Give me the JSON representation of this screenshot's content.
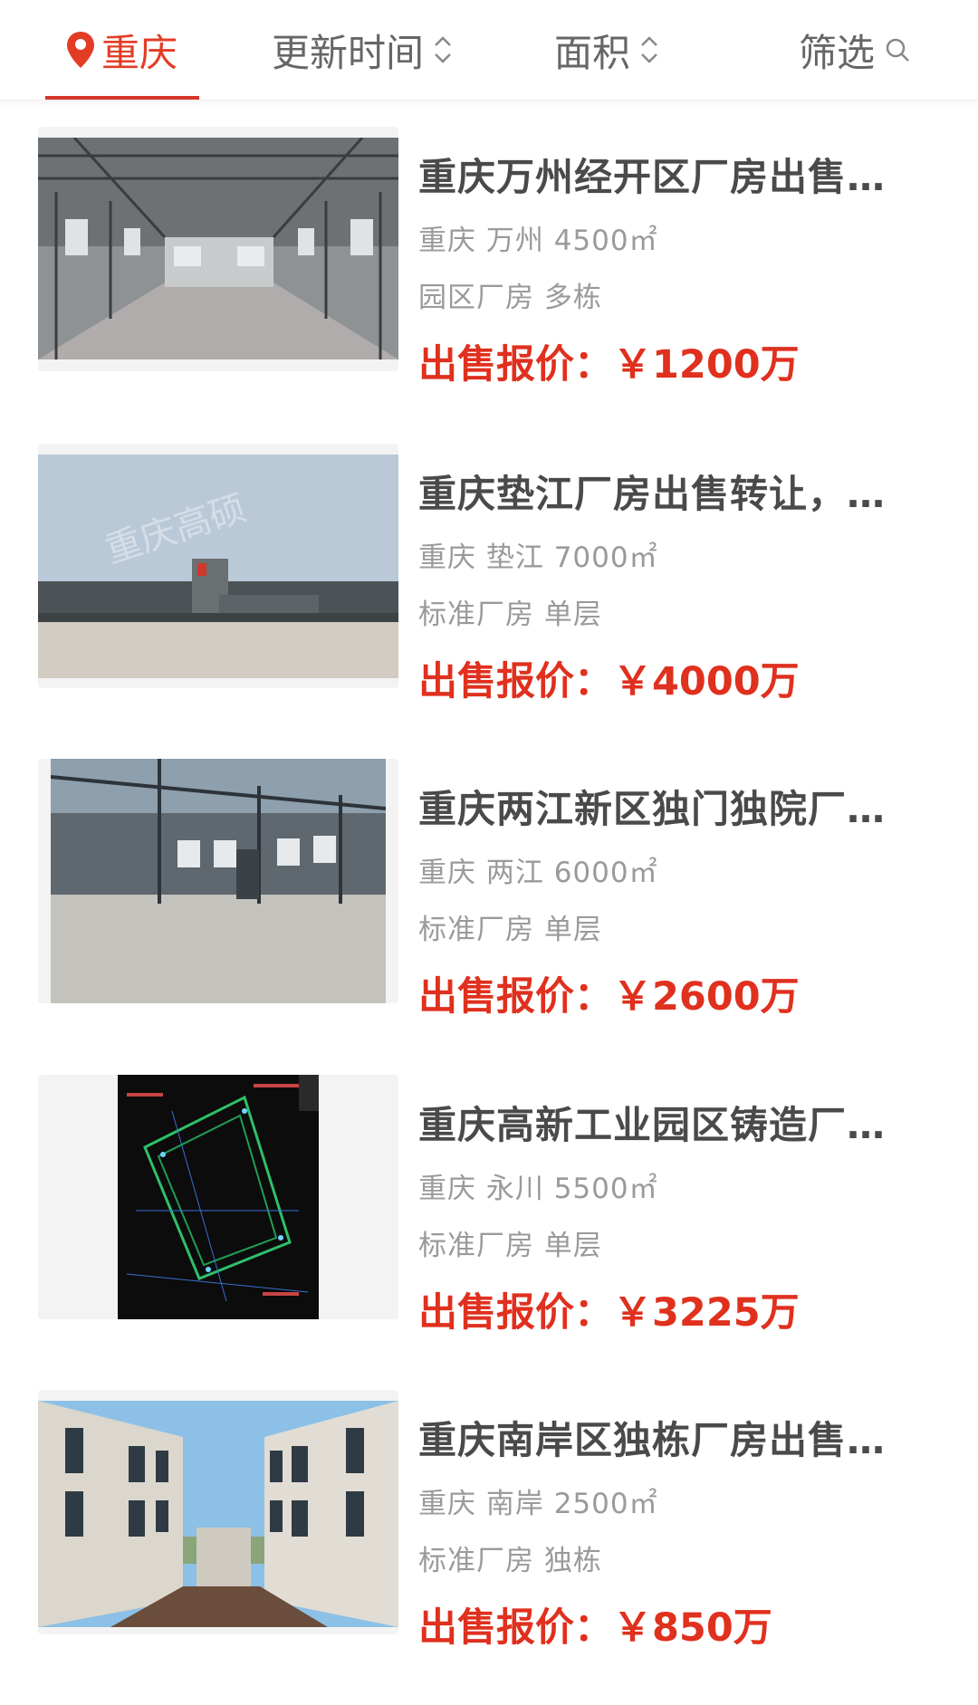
{
  "filter_bar": {
    "city": "重庆",
    "update_time": "更新时间",
    "area": "面积",
    "filter": "筛选"
  },
  "colors": {
    "accent_red": "#e0301e",
    "title_gray": "#4a4a4a",
    "meta_gray": "#9a9a9a"
  },
  "listings": [
    {
      "title": "重庆万州经开区厂房出售…",
      "location": "重庆 万州 4500㎡",
      "type": "园区厂房 多栋",
      "price_label": "出售报价：",
      "price": "￥1200万"
    },
    {
      "title": "重庆垫江厂房出售转让，…",
      "location": "重庆 垫江 7000㎡",
      "type": "标准厂房 单层",
      "price_label": "出售报价：",
      "price": "￥4000万",
      "watermark": "重庆高硕"
    },
    {
      "title": "重庆两江新区独门独院厂…",
      "location": "重庆 两江 6000㎡",
      "type": "标准厂房 单层",
      "price_label": "出售报价：",
      "price": "￥2600万"
    },
    {
      "title": "重庆高新工业园区铸造厂…",
      "location": "重庆 永川 5500㎡",
      "type": "标准厂房 单层",
      "price_label": "出售报价：",
      "price": "￥3225万"
    },
    {
      "title": "重庆南岸区独栋厂房出售…",
      "location": "重庆 南岸 2500㎡",
      "type": "标准厂房 独栋",
      "price_label": "出售报价：",
      "price": "￥850万"
    }
  ]
}
